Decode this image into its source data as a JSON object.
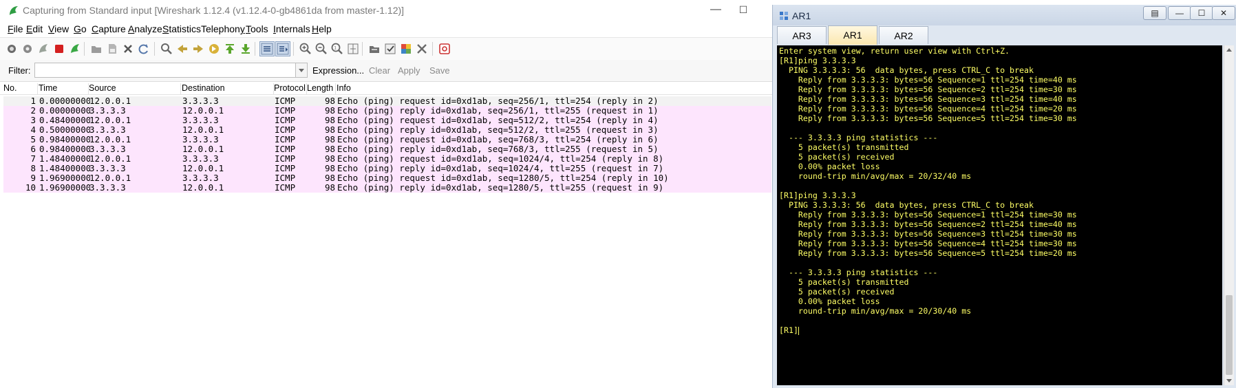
{
  "wireshark": {
    "title": "Capturing from Standard input    [Wireshark 1.12.4  (v1.12.4-0-gb4861da from master-1.12)]",
    "menu": [
      {
        "u": "F",
        "rest": "ile"
      },
      {
        "u": "E",
        "rest": "dit"
      },
      {
        "u": "V",
        "rest": "iew"
      },
      {
        "u": "G",
        "rest": "o"
      },
      {
        "u": "C",
        "rest": "apture"
      },
      {
        "u": "A",
        "rest": "nalyze"
      },
      {
        "u": "S",
        "rest": "tatistics"
      },
      {
        "u": "",
        "rest": "Telephon",
        "u2": "y"
      },
      {
        "u": "T",
        "rest": "ools"
      },
      {
        "u": "I",
        "rest": "nternals"
      },
      {
        "u": "H",
        "rest": "elp"
      }
    ],
    "filter": {
      "label": "Filter:",
      "value": "",
      "expression": "Expression...",
      "clear": "Clear",
      "apply": "Apply",
      "save": "Save"
    },
    "columns": [
      "No.",
      "Time",
      "Source",
      "Destination",
      "Protocol",
      "Length",
      "Info"
    ],
    "packets": [
      {
        "no": "1",
        "time": "0.00000000",
        "src": "12.0.0.1",
        "dst": "3.3.3.3",
        "proto": "ICMP",
        "len": "98",
        "info": "Echo (ping) request  id=0xd1ab, seq=256/1, ttl=254 (reply in 2)"
      },
      {
        "no": "2",
        "time": "0.00000000",
        "src": "3.3.3.3",
        "dst": "12.0.0.1",
        "proto": "ICMP",
        "len": "98",
        "info": "Echo (ping) reply    id=0xd1ab, seq=256/1, ttl=255 (request in 1)"
      },
      {
        "no": "3",
        "time": "0.48400000",
        "src": "12.0.0.1",
        "dst": "3.3.3.3",
        "proto": "ICMP",
        "len": "98",
        "info": "Echo (ping) request  id=0xd1ab, seq=512/2, ttl=254 (reply in 4)"
      },
      {
        "no": "4",
        "time": "0.50000000",
        "src": "3.3.3.3",
        "dst": "12.0.0.1",
        "proto": "ICMP",
        "len": "98",
        "info": "Echo (ping) reply    id=0xd1ab, seq=512/2, ttl=255 (request in 3)"
      },
      {
        "no": "5",
        "time": "0.98400000",
        "src": "12.0.0.1",
        "dst": "3.3.3.3",
        "proto": "ICMP",
        "len": "98",
        "info": "Echo (ping) request  id=0xd1ab, seq=768/3, ttl=254 (reply in 6)"
      },
      {
        "no": "6",
        "time": "0.98400000",
        "src": "3.3.3.3",
        "dst": "12.0.0.1",
        "proto": "ICMP",
        "len": "98",
        "info": "Echo (ping) reply    id=0xd1ab, seq=768/3, ttl=255 (request in 5)"
      },
      {
        "no": "7",
        "time": "1.48400000",
        "src": "12.0.0.1",
        "dst": "3.3.3.3",
        "proto": "ICMP",
        "len": "98",
        "info": "Echo (ping) request  id=0xd1ab, seq=1024/4, ttl=254 (reply in 8)"
      },
      {
        "no": "8",
        "time": "1.48400000",
        "src": "3.3.3.3",
        "dst": "12.0.0.1",
        "proto": "ICMP",
        "len": "98",
        "info": "Echo (ping) reply    id=0xd1ab, seq=1024/4, ttl=255 (request in 7)"
      },
      {
        "no": "9",
        "time": "1.96900000",
        "src": "12.0.0.1",
        "dst": "3.3.3.3",
        "proto": "ICMP",
        "len": "98",
        "info": "Echo (ping) request  id=0xd1ab, seq=1280/5, ttl=254 (reply in 10)"
      },
      {
        "no": "10",
        "time": "1.96900000",
        "src": "3.3.3.3",
        "dst": "12.0.0.1",
        "proto": "ICMP",
        "len": "98",
        "info": "Echo (ping) reply    id=0xd1ab, seq=1280/5, ttl=255 (request in 9)"
      }
    ],
    "colors": {
      "selected_row": "#f2f2f2",
      "icmp_row": "#fde5fd"
    }
  },
  "terminal": {
    "title": "AR1",
    "tabs": [
      "AR3",
      "AR1",
      "AR2"
    ],
    "active_tab": "AR1",
    "lines": [
      "Enter system view, return user view with Ctrl+Z.",
      "[R1]ping 3.3.3.3",
      "  PING 3.3.3.3: 56  data bytes, press CTRL_C to break",
      "    Reply from 3.3.3.3: bytes=56 Sequence=1 ttl=254 time=40 ms",
      "    Reply from 3.3.3.3: bytes=56 Sequence=2 ttl=254 time=30 ms",
      "    Reply from 3.3.3.3: bytes=56 Sequence=3 ttl=254 time=40 ms",
      "    Reply from 3.3.3.3: bytes=56 Sequence=4 ttl=254 time=20 ms",
      "    Reply from 3.3.3.3: bytes=56 Sequence=5 ttl=254 time=30 ms",
      "",
      "  --- 3.3.3.3 ping statistics ---",
      "    5 packet(s) transmitted",
      "    5 packet(s) received",
      "    0.00% packet loss",
      "    round-trip min/avg/max = 20/32/40 ms",
      "",
      "[R1]ping 3.3.3.3",
      "  PING 3.3.3.3: 56  data bytes, press CTRL_C to break",
      "    Reply from 3.3.3.3: bytes=56 Sequence=1 ttl=254 time=30 ms",
      "    Reply from 3.3.3.3: bytes=56 Sequence=2 ttl=254 time=40 ms",
      "    Reply from 3.3.3.3: bytes=56 Sequence=3 ttl=254 time=30 ms",
      "    Reply from 3.3.3.3: bytes=56 Sequence=4 ttl=254 time=30 ms",
      "    Reply from 3.3.3.3: bytes=56 Sequence=5 ttl=254 time=20 ms",
      "",
      "  --- 3.3.3.3 ping statistics ---",
      "    5 packet(s) transmitted",
      "    5 packet(s) received",
      "    0.00% packet loss",
      "    round-trip min/avg/max = 20/30/40 ms",
      "",
      "[R1]"
    ],
    "colors": {
      "background": "#000000",
      "text": "#ffff66"
    }
  },
  "icons": {
    "toolbar": [
      "interface-list-icon",
      "capture-options-icon",
      "start-capture-icon",
      "stop-capture-icon",
      "restart-capture-icon",
      "open-file-icon",
      "save-file-icon",
      "close-file-icon",
      "reload-icon",
      "find-packet-icon",
      "go-back-icon",
      "go-forward-icon",
      "go-to-packet-icon",
      "go-first-icon",
      "go-last-icon",
      "colorize-icon",
      "auto-scroll-icon",
      "zoom-in-icon",
      "zoom-out-icon",
      "zoom-normal-icon",
      "resize-columns-icon",
      "capture-filters-icon",
      "display-filters-icon",
      "coloring-rules-icon",
      "preferences-icon",
      "help-icon"
    ]
  }
}
